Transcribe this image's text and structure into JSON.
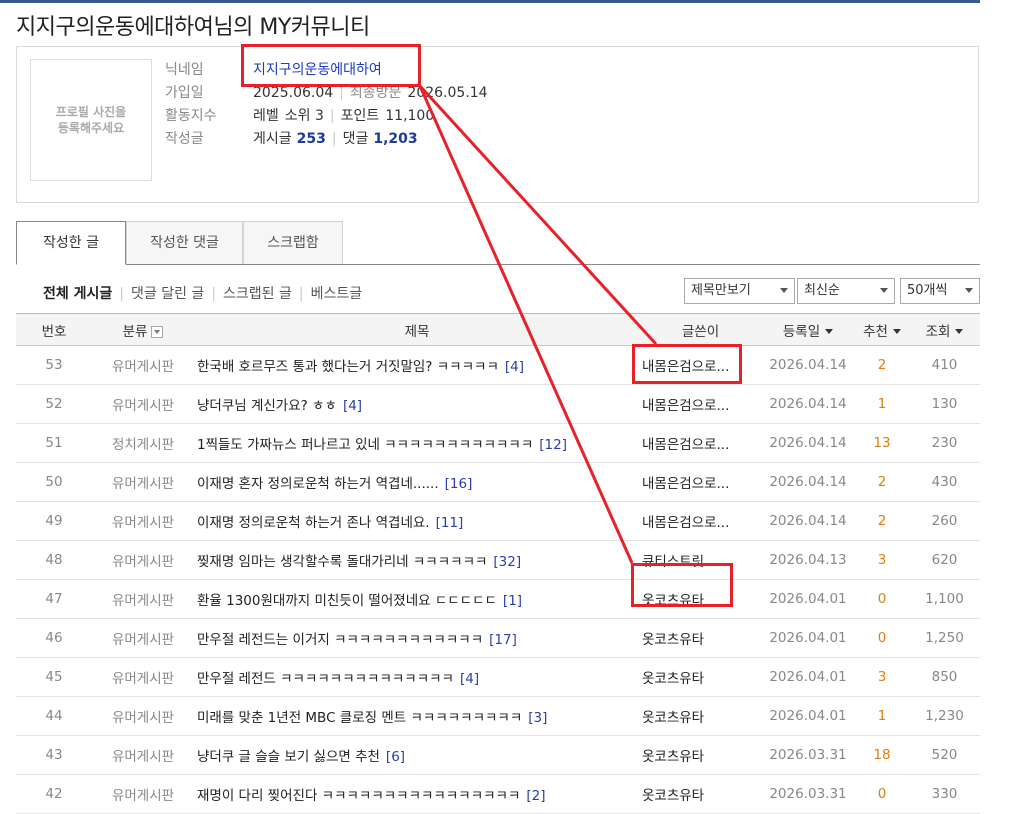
{
  "page_title": "지지구의운동에대하여님의 MY커뮤니티",
  "profile": {
    "photo_placeholder": "프로필 사진을 등록해주세요",
    "nickname_label": "닉네임",
    "nickname": "지지구의운동에대하여",
    "join_label": "가입일",
    "join_date": "2025.06.04",
    "last_visit_label": "최종방문",
    "last_visit": "2026.05.14",
    "activity_label": "활동지수",
    "level_label": "레벨",
    "level_value": "소위 3",
    "point_label": "포인트",
    "point_value": "11,100",
    "posts_label": "작성글",
    "post_count_label": "게시글",
    "post_count": "253",
    "comment_count_label": "댓글",
    "comment_count": "1,203"
  },
  "tabs": [
    "작성한 글",
    "작성한 댓글",
    "스크랩함"
  ],
  "filters": [
    "전체 게시글",
    "댓글 달린 글",
    "스크랩된 글",
    "베스트글"
  ],
  "selects": {
    "view": "제목만보기",
    "sort": "최신순",
    "count": "50개씩"
  },
  "table": {
    "headers": {
      "no": "번호",
      "category": "분류",
      "title": "제목",
      "author": "글쓴이",
      "date": "등록일",
      "recommend": "추천",
      "views": "조회"
    },
    "rows": [
      {
        "no": "53",
        "category": "유머게시판",
        "title": "한국배 호르무즈 통과 했다는거 거짓말임? ㅋㅋㅋㅋㅋ",
        "comments": "[4]",
        "author": "내몸은검으로...",
        "date": "2026.04.14",
        "recommend": "2",
        "views": "410"
      },
      {
        "no": "52",
        "category": "유머게시판",
        "title": "냥더쿠님 계신가요? ㅎㅎ",
        "comments": "[4]",
        "author": "내몸은검으로...",
        "date": "2026.04.14",
        "recommend": "1",
        "views": "130"
      },
      {
        "no": "51",
        "category": "정치게시판",
        "title": "1찍들도 가짜뉴스 퍼나르고 있네 ㅋㅋㅋㅋㅋㅋㅋㅋㅋㅋㅋㅋ",
        "comments": "[12]",
        "author": "내몸은검으로...",
        "date": "2026.04.14",
        "recommend": "13",
        "views": "230"
      },
      {
        "no": "50",
        "category": "유머게시판",
        "title": "이재명 혼자 정의로운척 하는거 역겹네......",
        "comments": "[16]",
        "author": "내몸은검으로...",
        "date": "2026.04.14",
        "recommend": "2",
        "views": "430"
      },
      {
        "no": "49",
        "category": "유머게시판",
        "title": "이재명 정의로운척 하는거 존나 역겹네요.",
        "comments": "[11]",
        "author": "내몸은검으로...",
        "date": "2026.04.14",
        "recommend": "2",
        "views": "260"
      },
      {
        "no": "48",
        "category": "유머게시판",
        "title": "찢재명 임마는 생각할수록 돌대가리네 ㅋㅋㅋㅋㅋㅋ",
        "comments": "[32]",
        "author": "큐티스트릿",
        "date": "2026.04.13",
        "recommend": "3",
        "views": "620"
      },
      {
        "no": "47",
        "category": "유머게시판",
        "title": "환율 1300원대까지 미친듯이 떨어졌네요 ㄷㄷㄷㄷㄷ",
        "comments": "[1]",
        "author": "옷코츠유타",
        "date": "2026.04.01",
        "recommend": "0",
        "views": "1,100"
      },
      {
        "no": "46",
        "category": "유머게시판",
        "title": "만우절 레전드는 이거지 ㅋㅋㅋㅋㅋㅋㅋㅋㅋㅋㅋㅋ",
        "comments": "[17]",
        "author": "옷코츠유타",
        "date": "2026.04.01",
        "recommend": "0",
        "views": "1,250"
      },
      {
        "no": "45",
        "category": "유머게시판",
        "title": "만우절 레전드 ㅋㅋㅋㅋㅋㅋㅋㅋㅋㅋㅋㅋㅋㅋ",
        "comments": "[4]",
        "author": "옷코츠유타",
        "date": "2026.04.01",
        "recommend": "3",
        "views": "850"
      },
      {
        "no": "44",
        "category": "유머게시판",
        "title": "미래를 맞춘 1년전 MBC 클로징 멘트 ㅋㅋㅋㅋㅋㅋㅋㅋㅋ",
        "comments": "[3]",
        "author": "옷코츠유타",
        "date": "2026.04.01",
        "recommend": "1",
        "views": "1,230"
      },
      {
        "no": "43",
        "category": "유머게시판",
        "title": "냥더쿠 글 슬슬 보기 싫으면 추천",
        "comments": "[6]",
        "author": "옷코츠유타",
        "date": "2026.03.31",
        "recommend": "18",
        "views": "520"
      },
      {
        "no": "42",
        "category": "유머게시판",
        "title": "재명이 다리 찢어진다 ㅋㅋㅋㅋㅋㅋㅋㅋㅋㅋㅋㅋㅋㅋㅋㅋ",
        "comments": "[2]",
        "author": "옷코츠유타",
        "date": "2026.03.31",
        "recommend": "0",
        "views": "330"
      }
    ]
  },
  "annotation_color": "#e8202a"
}
